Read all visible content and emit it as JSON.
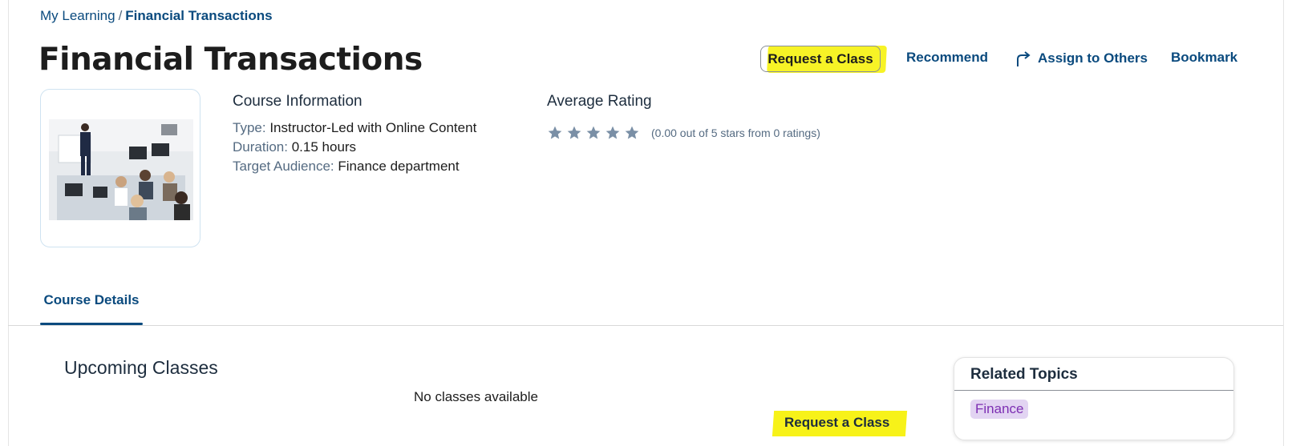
{
  "breadcrumb": {
    "parent": "My Learning",
    "separator": "/",
    "current": "Financial Transactions"
  },
  "page": {
    "title": "Financial Transactions"
  },
  "actions": {
    "request_class": "Request a Class",
    "recommend": "Recommend",
    "assign": "Assign to Others",
    "bookmark": "Bookmark"
  },
  "course_info": {
    "heading": "Course Information",
    "type_label": "Type:",
    "type_value": "Instructor-Led with Online Content",
    "duration_label": "Duration:",
    "duration_value": "0.15 hours",
    "audience_label": "Target Audience:",
    "audience_value": "Finance department"
  },
  "rating": {
    "heading": "Average Rating",
    "stars_filled": 0,
    "stars_total": 5,
    "summary": "(0.00 out of 5 stars from 0 ratings)"
  },
  "tabs": [
    {
      "label": "Course Details",
      "selected": true
    }
  ],
  "upcoming": {
    "title": "Upcoming Classes",
    "empty_text": "No classes available",
    "request_link": "Request a Class"
  },
  "related_topics": {
    "heading": "Related Topics",
    "topics": [
      "Finance"
    ]
  },
  "colors": {
    "link": "#0a4a7e",
    "highlight": "#f6f100",
    "star": "#7a8fa6",
    "topic_chip_bg": "#e2d4f2",
    "topic_chip_text": "#7d2fb3"
  },
  "icons": {
    "assign": "share-arrow-icon",
    "star": "star-icon"
  }
}
